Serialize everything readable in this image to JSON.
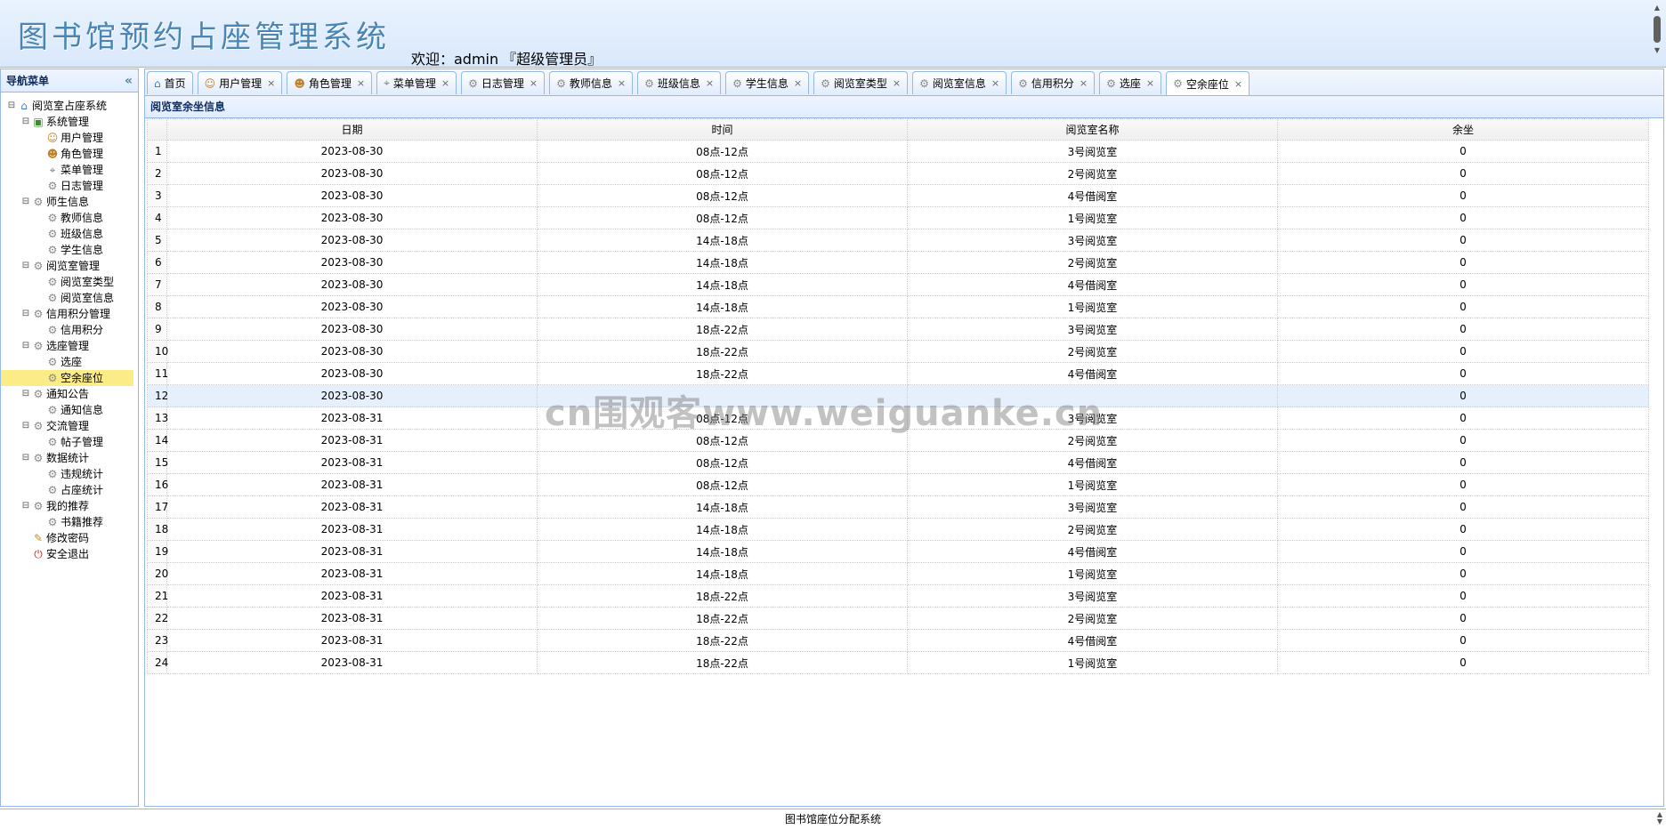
{
  "header": {
    "title": "图书馆预约占座管理系统",
    "welcome_prefix": "欢迎：admin",
    "role": "『超级管理员』"
  },
  "nav": {
    "title": "导航菜单",
    "collapse_glyph": "«",
    "items": [
      {
        "label": "阅览室占座系统",
        "level": 1,
        "toggle": "⊟",
        "icon": "home-icon"
      },
      {
        "label": "系统管理",
        "level": 2,
        "toggle": "⊟",
        "icon": "folder-green-icon"
      },
      {
        "label": "用户管理",
        "level": 3,
        "icon": "user-icon"
      },
      {
        "label": "角色管理",
        "level": 3,
        "icon": "role-icon"
      },
      {
        "label": "菜单管理",
        "level": 3,
        "icon": "menu-tree-icon"
      },
      {
        "label": "日志管理",
        "level": 3,
        "icon": "gear-icon"
      },
      {
        "label": "师生信息",
        "level": 2,
        "toggle": "⊟",
        "icon": "gear-icon"
      },
      {
        "label": "教师信息",
        "level": 3,
        "icon": "gear-icon"
      },
      {
        "label": "班级信息",
        "level": 3,
        "icon": "gear-icon"
      },
      {
        "label": "学生信息",
        "level": 3,
        "icon": "gear-icon"
      },
      {
        "label": "阅览室管理",
        "level": 2,
        "toggle": "⊟",
        "icon": "gear-icon"
      },
      {
        "label": "阅览室类型",
        "level": 3,
        "icon": "gear-icon"
      },
      {
        "label": "阅览室信息",
        "level": 3,
        "icon": "gear-icon"
      },
      {
        "label": "信用积分管理",
        "level": 2,
        "toggle": "⊟",
        "icon": "gear-icon"
      },
      {
        "label": "信用积分",
        "level": 3,
        "icon": "gear-icon"
      },
      {
        "label": "选座管理",
        "level": 2,
        "toggle": "⊟",
        "icon": "gear-icon"
      },
      {
        "label": "选座",
        "level": 3,
        "icon": "gear-icon"
      },
      {
        "label": "空余座位",
        "level": 3,
        "icon": "gear-icon",
        "selected": true
      },
      {
        "label": "通知公告",
        "level": 2,
        "toggle": "⊟",
        "icon": "gear-icon"
      },
      {
        "label": "通知信息",
        "level": 3,
        "icon": "gear-icon"
      },
      {
        "label": "交流管理",
        "level": 2,
        "toggle": "⊟",
        "icon": "gear-icon"
      },
      {
        "label": "帖子管理",
        "level": 3,
        "icon": "gear-icon"
      },
      {
        "label": "数据统计",
        "level": 2,
        "toggle": "⊟",
        "icon": "gear-icon"
      },
      {
        "label": "违规统计",
        "level": 3,
        "icon": "gear-icon"
      },
      {
        "label": "占座统计",
        "level": 3,
        "icon": "gear-icon"
      },
      {
        "label": "我的推荐",
        "level": 2,
        "toggle": "⊟",
        "icon": "gear-icon"
      },
      {
        "label": "书籍推荐",
        "level": 3,
        "icon": "gear-icon"
      },
      {
        "label": "修改密码",
        "level": 2,
        "icon": "password-icon"
      },
      {
        "label": "安全退出",
        "level": 2,
        "icon": "exit-icon"
      }
    ]
  },
  "tabs": [
    {
      "label": "首页",
      "icon": "home-icon",
      "closable": false
    },
    {
      "label": "用户管理",
      "icon": "user-icon",
      "closable": true
    },
    {
      "label": "角色管理",
      "icon": "role-icon",
      "closable": true
    },
    {
      "label": "菜单管理",
      "icon": "menu-tree-icon",
      "closable": true
    },
    {
      "label": "日志管理",
      "icon": "gear-icon",
      "closable": true
    },
    {
      "label": "教师信息",
      "icon": "gear-icon",
      "closable": true
    },
    {
      "label": "班级信息",
      "icon": "gear-icon",
      "closable": true
    },
    {
      "label": "学生信息",
      "icon": "gear-icon",
      "closable": true
    },
    {
      "label": "阅览室类型",
      "icon": "gear-icon",
      "closable": true
    },
    {
      "label": "阅览室信息",
      "icon": "gear-icon",
      "closable": true
    },
    {
      "label": "信用积分",
      "icon": "gear-icon",
      "closable": true
    },
    {
      "label": "选座",
      "icon": "gear-icon",
      "closable": true
    },
    {
      "label": "空余座位",
      "icon": "gear-icon",
      "closable": true,
      "active": true
    }
  ],
  "tab_close_glyph": "×",
  "panel": {
    "title": "阅览室余坐信息",
    "columns": [
      "日期",
      "时间",
      "阅览室名称",
      "余坐"
    ],
    "rows": [
      [
        "2023-08-30",
        "08点-12点",
        "3号阅览室",
        "0"
      ],
      [
        "2023-08-30",
        "08点-12点",
        "2号阅览室",
        "0"
      ],
      [
        "2023-08-30",
        "08点-12点",
        "4号借阅室",
        "0"
      ],
      [
        "2023-08-30",
        "08点-12点",
        "1号阅览室",
        "0"
      ],
      [
        "2023-08-30",
        "14点-18点",
        "3号阅览室",
        "0"
      ],
      [
        "2023-08-30",
        "14点-18点",
        "2号阅览室",
        "0"
      ],
      [
        "2023-08-30",
        "14点-18点",
        "4号借阅室",
        "0"
      ],
      [
        "2023-08-30",
        "14点-18点",
        "1号阅览室",
        "0"
      ],
      [
        "2023-08-30",
        "18点-22点",
        "3号阅览室",
        "0"
      ],
      [
        "2023-08-30",
        "18点-22点",
        "2号阅览室",
        "0"
      ],
      [
        "2023-08-30",
        "18点-22点",
        "4号借阅室",
        "0"
      ],
      [
        "2023-08-30",
        "",
        "",
        "0"
      ],
      [
        "2023-08-31",
        "08点-12点",
        "3号阅览室",
        "0"
      ],
      [
        "2023-08-31",
        "08点-12点",
        "2号阅览室",
        "0"
      ],
      [
        "2023-08-31",
        "08点-12点",
        "4号借阅室",
        "0"
      ],
      [
        "2023-08-31",
        "08点-12点",
        "1号阅览室",
        "0"
      ],
      [
        "2023-08-31",
        "14点-18点",
        "3号阅览室",
        "0"
      ],
      [
        "2023-08-31",
        "14点-18点",
        "2号阅览室",
        "0"
      ],
      [
        "2023-08-31",
        "14点-18点",
        "4号借阅室",
        "0"
      ],
      [
        "2023-08-31",
        "14点-18点",
        "1号阅览室",
        "0"
      ],
      [
        "2023-08-31",
        "18点-22点",
        "3号阅览室",
        "0"
      ],
      [
        "2023-08-31",
        "18点-22点",
        "2号阅览室",
        "0"
      ],
      [
        "2023-08-31",
        "18点-22点",
        "4号借阅室",
        "0"
      ],
      [
        "2023-08-31",
        "18点-22点",
        "1号阅览室",
        "0"
      ]
    ],
    "highlighted_row": 12
  },
  "watermark": "cn围观客www.weiguanke.cn",
  "footer": {
    "text": "图书馆座位分配系统"
  },
  "colors": {
    "border": "#95b8e7",
    "selected": "#fbec88",
    "title": "#4a86b4"
  }
}
